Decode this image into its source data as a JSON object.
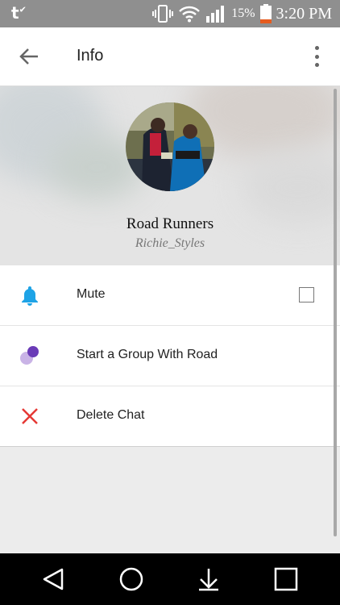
{
  "status_bar": {
    "carrier": "t",
    "battery_percent": "15%",
    "time": "3:20 PM",
    "icons": [
      "carrier-icon",
      "vibrate-icon",
      "wifi-icon",
      "signal-icon",
      "battery-icon"
    ]
  },
  "app_bar": {
    "title": "Info",
    "back_icon": "arrow-back-icon",
    "more_icon": "more-vert-icon"
  },
  "profile": {
    "name": "Road Runners",
    "handle": "Richie_Styles"
  },
  "menu": [
    {
      "label": "Mute",
      "icon": "bell-icon",
      "checked": false
    },
    {
      "label": "Start a Group With Road",
      "icon": "group-dots-icon"
    },
    {
      "label": "Delete Chat",
      "icon": "close-icon"
    }
  ],
  "colors": {
    "status_bar": "#8f8f8f",
    "bell": "#1ea3e6",
    "group_dark": "#6a3bb7",
    "group_light": "#c9b3e6",
    "delete": "#e53935",
    "battery_fill": "#e65c1f"
  },
  "nav_bar": [
    "back-triangle-icon",
    "home-circle-icon",
    "download-icon",
    "recents-square-icon"
  ]
}
